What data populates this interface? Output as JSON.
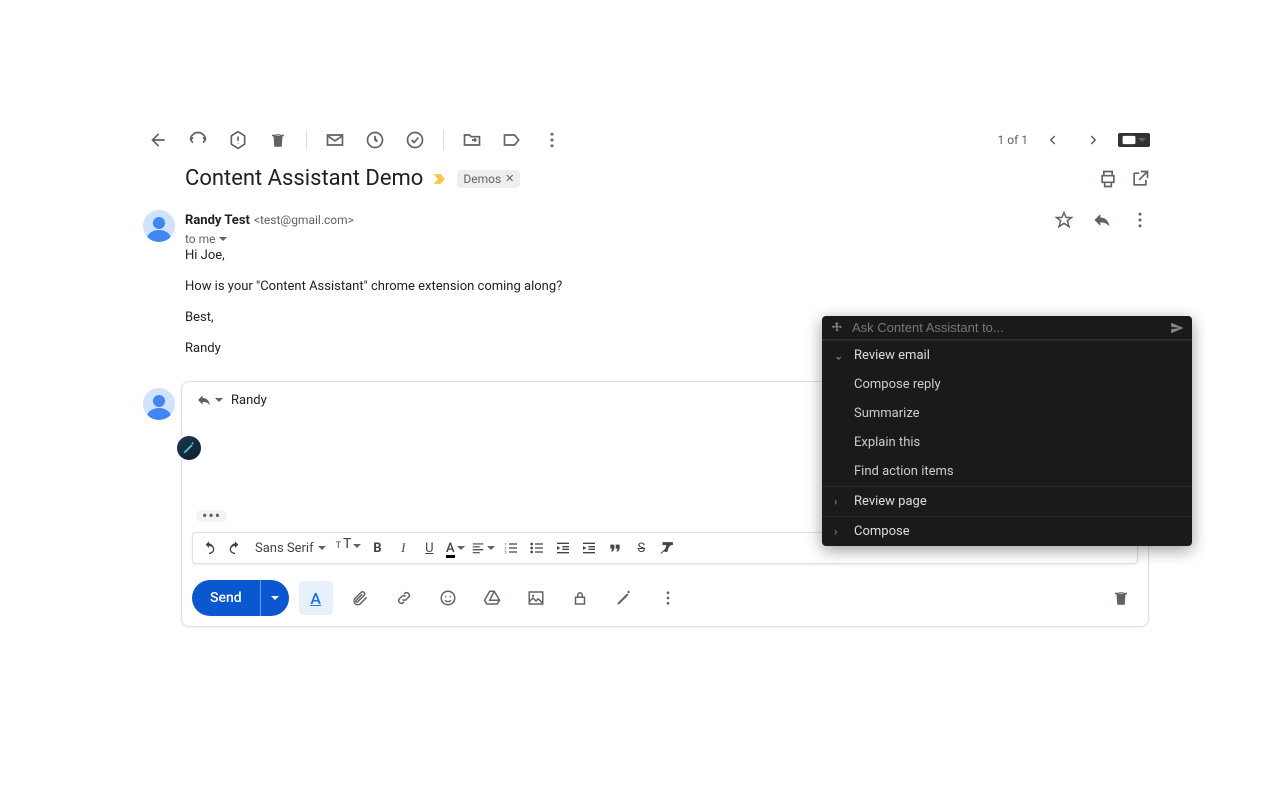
{
  "pager": {
    "count": "1 of 1"
  },
  "subject": "Content Assistant Demo",
  "label": "Demos",
  "sender": {
    "name": "Randy Test",
    "email": "<test@gmail.com>"
  },
  "to_line": "to me",
  "body": {
    "greeting": "Hi Joe,",
    "line1": "How is your \"Content Assistant\" chrome extension coming along?",
    "signoff": "Best,",
    "signature": "Randy"
  },
  "reply": {
    "recipient": "Randy",
    "font": "Sans Serif",
    "send_label": "Send"
  },
  "assistant": {
    "placeholder": "Ask Content Assistant to...",
    "sections": {
      "review_email": "Review email",
      "review_page": "Review page",
      "compose": "Compose"
    },
    "items": {
      "compose_reply": "Compose reply",
      "summarize": "Summarize",
      "explain": "Explain this",
      "actions": "Find action items"
    }
  }
}
